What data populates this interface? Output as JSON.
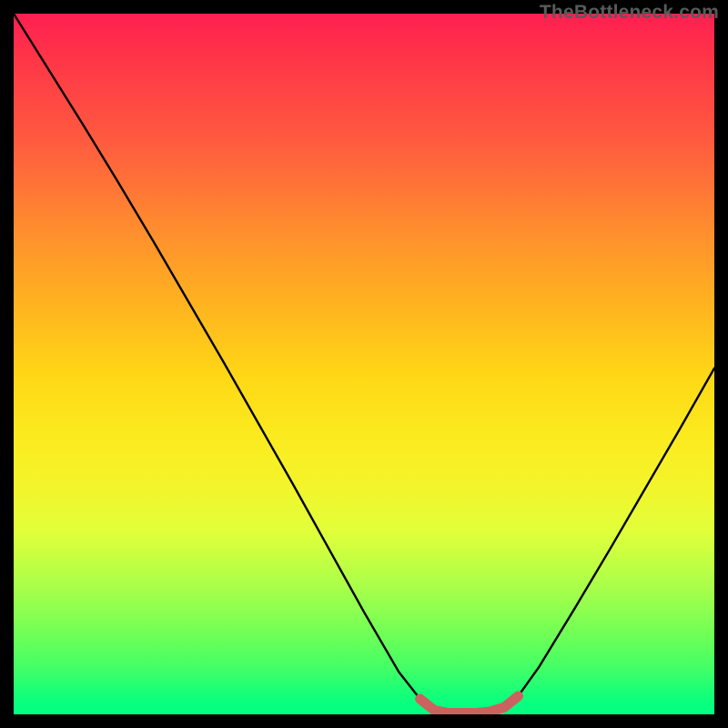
{
  "watermark": "TheBottleneck.com",
  "colors": {
    "background": "#000000",
    "curve": "#000000",
    "marker": "#cc625f",
    "gradient_top": "#ff1f51",
    "gradient_bottom": "#03ff82"
  },
  "chart_data": {
    "type": "line",
    "title": "",
    "xlabel": "",
    "ylabel": "",
    "xlim": [
      0,
      100
    ],
    "ylim": [
      0,
      100
    ],
    "grid": false,
    "legend": false,
    "series": [
      {
        "name": "curve",
        "x": [
          0,
          5,
          10,
          15,
          20,
          25,
          30,
          35,
          40,
          45,
          50,
          55,
          58,
          60,
          62,
          64,
          66,
          68,
          70,
          72,
          75,
          80,
          85,
          90,
          95,
          100
        ],
        "y": [
          100,
          92.0,
          84.0,
          75.8,
          67.4,
          58.8,
          50.2,
          41.4,
          32.6,
          23.6,
          14.6,
          6.0,
          2.2,
          0.6,
          0.2,
          0.2,
          0.2,
          0.4,
          1.0,
          2.6,
          6.8,
          15.0,
          23.4,
          32.0,
          40.6,
          49.4
        ]
      }
    ],
    "markers": [
      {
        "name": "flat-region",
        "x": [
          58,
          60,
          62,
          64,
          66,
          68,
          70,
          72
        ],
        "y": [
          2.2,
          0.6,
          0.2,
          0.2,
          0.2,
          0.4,
          1.0,
          2.6
        ]
      }
    ]
  }
}
